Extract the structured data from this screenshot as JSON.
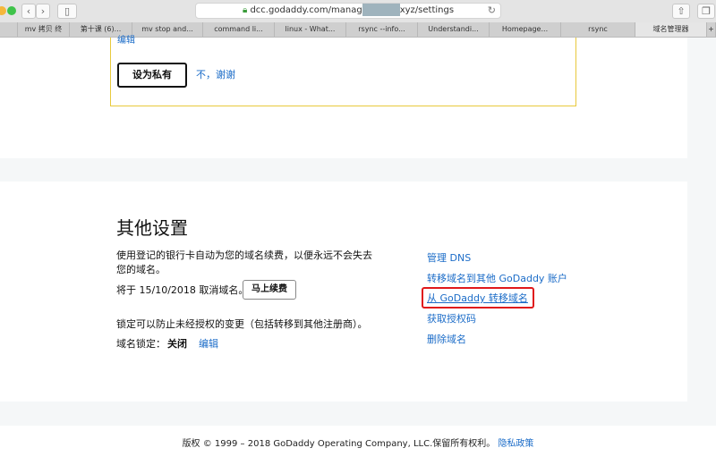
{
  "browser": {
    "url_prefix": "dcc.godaddy.com/manag",
    "url_suffix": "xyz/settings",
    "tabs": [
      "mv 拷贝 终",
      "第十课 (6)...",
      "mv stop and...",
      "command li...",
      "linux - What...",
      "rsync --info...",
      "Understandi...",
      "Homepage...",
      "rsync",
      "域名管理器"
    ]
  },
  "privacy": {
    "edit_link": "编辑",
    "make_private_button": "设为私有",
    "decline_link": "不，谢谢"
  },
  "other_settings": {
    "title": "其他设置",
    "auto_renew_text": "使用登记的银行卡自动为您的域名续费，以便永远不会失去您的域名。",
    "cancel_text": "将于 15/10/2018 取消域名。",
    "renew_button": "马上续费",
    "lock_text": "锁定可以防止未经授权的变更（包括转移到其他注册商）。",
    "lock_label": "域名锁定：",
    "lock_value": "关闭",
    "lock_edit": "编辑",
    "links": [
      "管理 DNS",
      "转移域名到其他 GoDaddy 账户",
      "从 GoDaddy 转移域名",
      "获取授权码",
      "删除域名"
    ]
  },
  "footer": {
    "copyright": "版权 © 1999 – 2018 GoDaddy Operating Company, LLC.保留所有权利。",
    "privacy_link": "隐私政策"
  }
}
